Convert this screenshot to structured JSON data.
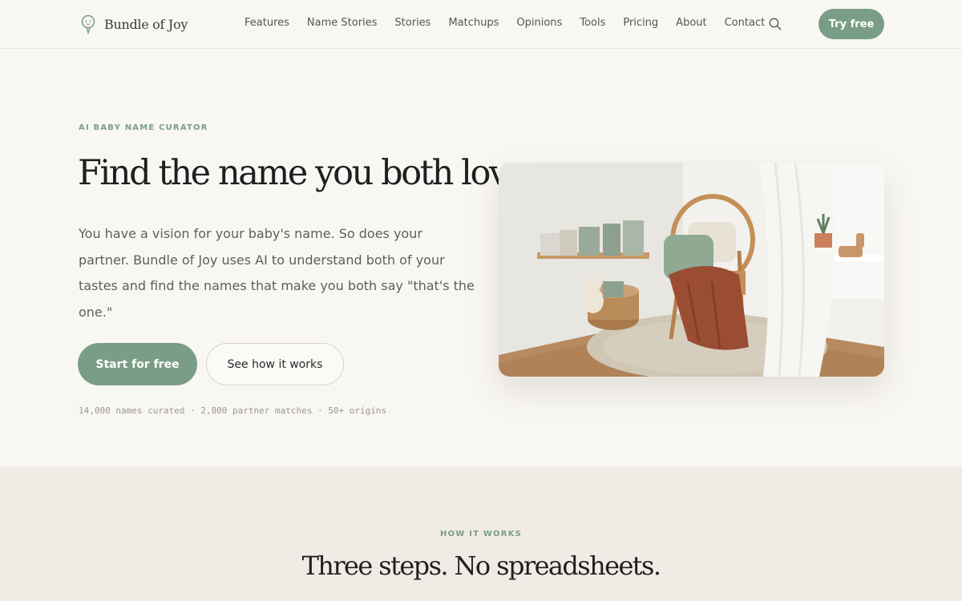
{
  "brand": {
    "name": "Bundle of Joy",
    "accent": "#7a9e85"
  },
  "nav": {
    "items": [
      "Features",
      "Name Stories",
      "Stories",
      "Matchups",
      "Opinions",
      "Tools",
      "Pricing",
      "About",
      "Contact"
    ],
    "search_icon": "search-icon",
    "cta": "Try free"
  },
  "hero": {
    "eyebrow": "AI BABY NAME CURATOR",
    "title": "Find the name you both love",
    "description": "You have a vision for your baby's name. So does your partner. Bundle of Joy uses AI to understand both of your tastes and find the names that make you both say \"that's the one.\"",
    "primary_cta": "Start for free",
    "secondary_cta": "See how it works",
    "stats": "14,000 names curated · 2,800 partner matches · 50+ origins"
  },
  "how": {
    "eyebrow": "HOW IT WORKS",
    "title": "Three steps. No spreadsheets."
  }
}
